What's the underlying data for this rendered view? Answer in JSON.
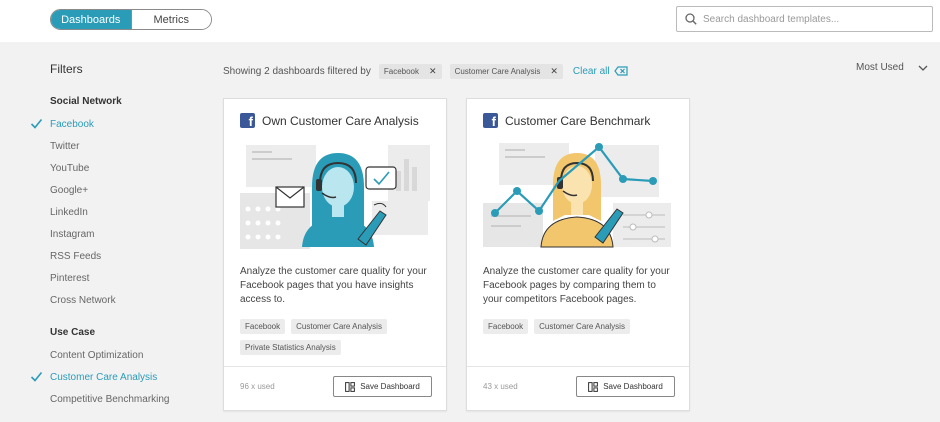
{
  "tabs": {
    "dashboards": "Dashboards",
    "metrics": "Metrics"
  },
  "search": {
    "placeholder": "Search dashboard templates..."
  },
  "filters": {
    "title": "Filters",
    "social_network": {
      "title": "Social Network",
      "items": [
        {
          "label": "Facebook",
          "selected": true
        },
        {
          "label": "Twitter",
          "selected": false
        },
        {
          "label": "YouTube",
          "selected": false
        },
        {
          "label": "Google+",
          "selected": false
        },
        {
          "label": "LinkedIn",
          "selected": false
        },
        {
          "label": "Instagram",
          "selected": false
        },
        {
          "label": "RSS Feeds",
          "selected": false
        },
        {
          "label": "Pinterest",
          "selected": false
        },
        {
          "label": "Cross Network",
          "selected": false
        }
      ]
    },
    "use_case": {
      "title": "Use Case",
      "items": [
        {
          "label": "Content Optimization",
          "selected": false
        },
        {
          "label": "Customer Care Analysis",
          "selected": true
        },
        {
          "label": "Competitive Benchmarking",
          "selected": false
        }
      ]
    }
  },
  "results": {
    "summary": "Showing 2 dashboards filtered by",
    "chips": [
      "Facebook",
      "Customer Care Analysis"
    ],
    "clear_all": "Clear all"
  },
  "sort": {
    "label": "Most Used"
  },
  "cards": [
    {
      "title": "Own Customer Care Analysis",
      "description": "Analyze the customer care quality for your Facebook pages that you have insights access to.",
      "tags": [
        "Facebook",
        "Customer Care Analysis",
        "Private Statistics Analysis"
      ],
      "usage": "96 x used",
      "button": "Save Dashboard",
      "accent": "#2a9cb8"
    },
    {
      "title": "Customer Care Benchmark",
      "description": "Analyze the customer care quality for your Facebook pages by comparing them to your competitors Facebook pages.",
      "tags": [
        "Facebook",
        "Customer Care Analysis"
      ],
      "usage": "43 x used",
      "button": "Save Dashboard",
      "accent": "#f2c66d"
    }
  ],
  "colors": {
    "accent": "#2a9cb8",
    "facebook": "#3b5998"
  },
  "icons": [
    "search-icon",
    "check-icon",
    "close-icon",
    "backspace-icon",
    "chevron-down-icon",
    "facebook-icon",
    "dashboard-icon"
  ]
}
